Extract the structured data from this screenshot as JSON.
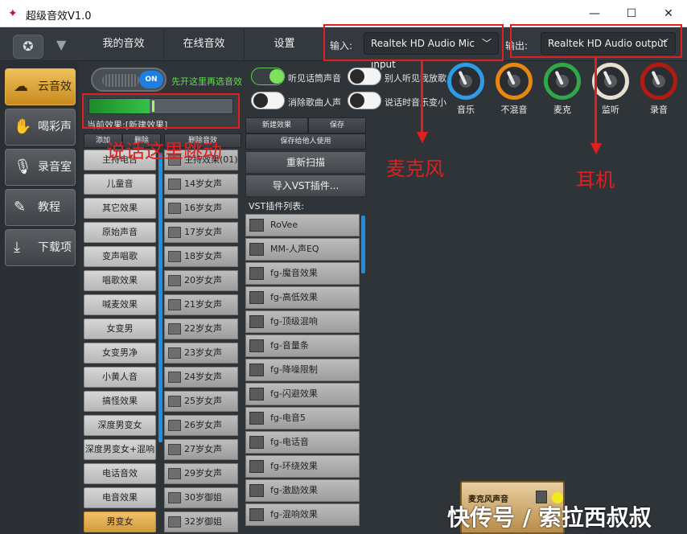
{
  "window": {
    "title": "超级音效V1.0",
    "minimize": "—",
    "maximize": "☐",
    "close": "✕"
  },
  "topbar": {
    "tabs": [
      "我的音效",
      "在线音效",
      "设置"
    ],
    "input_label": "输入:",
    "input_device": "Realtek HD Audio Mic input",
    "output_label": "输出:",
    "output_device": "Realtek HD Audio output"
  },
  "sidebar": {
    "items": [
      {
        "label": "云音效",
        "icon": "cloud-icon",
        "active": true
      },
      {
        "label": "喝彩声",
        "icon": "hand-icon",
        "active": false
      },
      {
        "label": "录音室",
        "icon": "microphone-icon",
        "active": false
      },
      {
        "label": "教程",
        "icon": "tutorial-icon",
        "active": false
      },
      {
        "label": "下载项",
        "icon": "download-icon",
        "active": false
      }
    ]
  },
  "controls": {
    "main_switch": "ON",
    "hint": "先开这里再选音效",
    "options": [
      {
        "label": "听见话筒声音",
        "on": true
      },
      {
        "label": "别人听见我放歌",
        "on": false
      },
      {
        "label": "消除歌曲人声",
        "on": false
      },
      {
        "label": "说话时音乐变小",
        "on": false
      }
    ],
    "current_effect": "当前效果:[新建效果]",
    "meter_level": 0.42
  },
  "knobs": [
    {
      "label": "音乐",
      "color": "#2e9be6"
    },
    {
      "label": "不混音",
      "color": "#e8870e"
    },
    {
      "label": "麦克",
      "color": "#2fa84a"
    },
    {
      "label": "监听",
      "color": "#e6e0d0"
    },
    {
      "label": "录音",
      "color": "#b21b12"
    }
  ],
  "category_buttons": [
    "添加",
    "删除"
  ],
  "categories": [
    "主持电台",
    "儿童音",
    "其它效果",
    "原始声音",
    "变声唱歌",
    "唱歌效果",
    "喊麦效果",
    "女变男",
    "女变男净",
    "小黄人音",
    "搞怪效果",
    "深度男变女",
    "深度男变女+混响",
    "电话音效",
    "电音效果",
    "男变女"
  ],
  "effect_buttons": [
    "删除音效"
  ],
  "effects": [
    "主持效果(01)",
    "14岁女声",
    "16岁女声",
    "17岁女声",
    "18岁女声",
    "20岁女声",
    "21岁女声",
    "22岁女声",
    "23岁女声",
    "24岁女声",
    "25岁女声",
    "26岁女声",
    "27岁女声",
    "29岁女声",
    "30岁御姐",
    "32岁御姐"
  ],
  "actions": {
    "new_effect": "新建效果",
    "save": "保存",
    "save_for_others": "保存给他人使用",
    "rescan": "重新扫描",
    "import_vst": "导入VST插件..."
  },
  "vst": {
    "title": "VST插件列表:",
    "items": [
      "RoVee",
      "MM-人声EQ",
      "fg-魔音效果",
      "fg-高低效果",
      "fg-顶级混响",
      "fg-音量条",
      "fg-降噪限制",
      "fg-闪避效果",
      "fg-电音5",
      "fg-电话音",
      "fg-环绕效果",
      "fg-激励效果",
      "fg-混响效果"
    ]
  },
  "mic_panel": {
    "title": "麦克风声音"
  },
  "annotations": {
    "speak_here": "说话这里跳动",
    "microphone": "麦克风",
    "headphones": "耳机"
  },
  "watermark": "快传号 / 索拉西叔叔"
}
